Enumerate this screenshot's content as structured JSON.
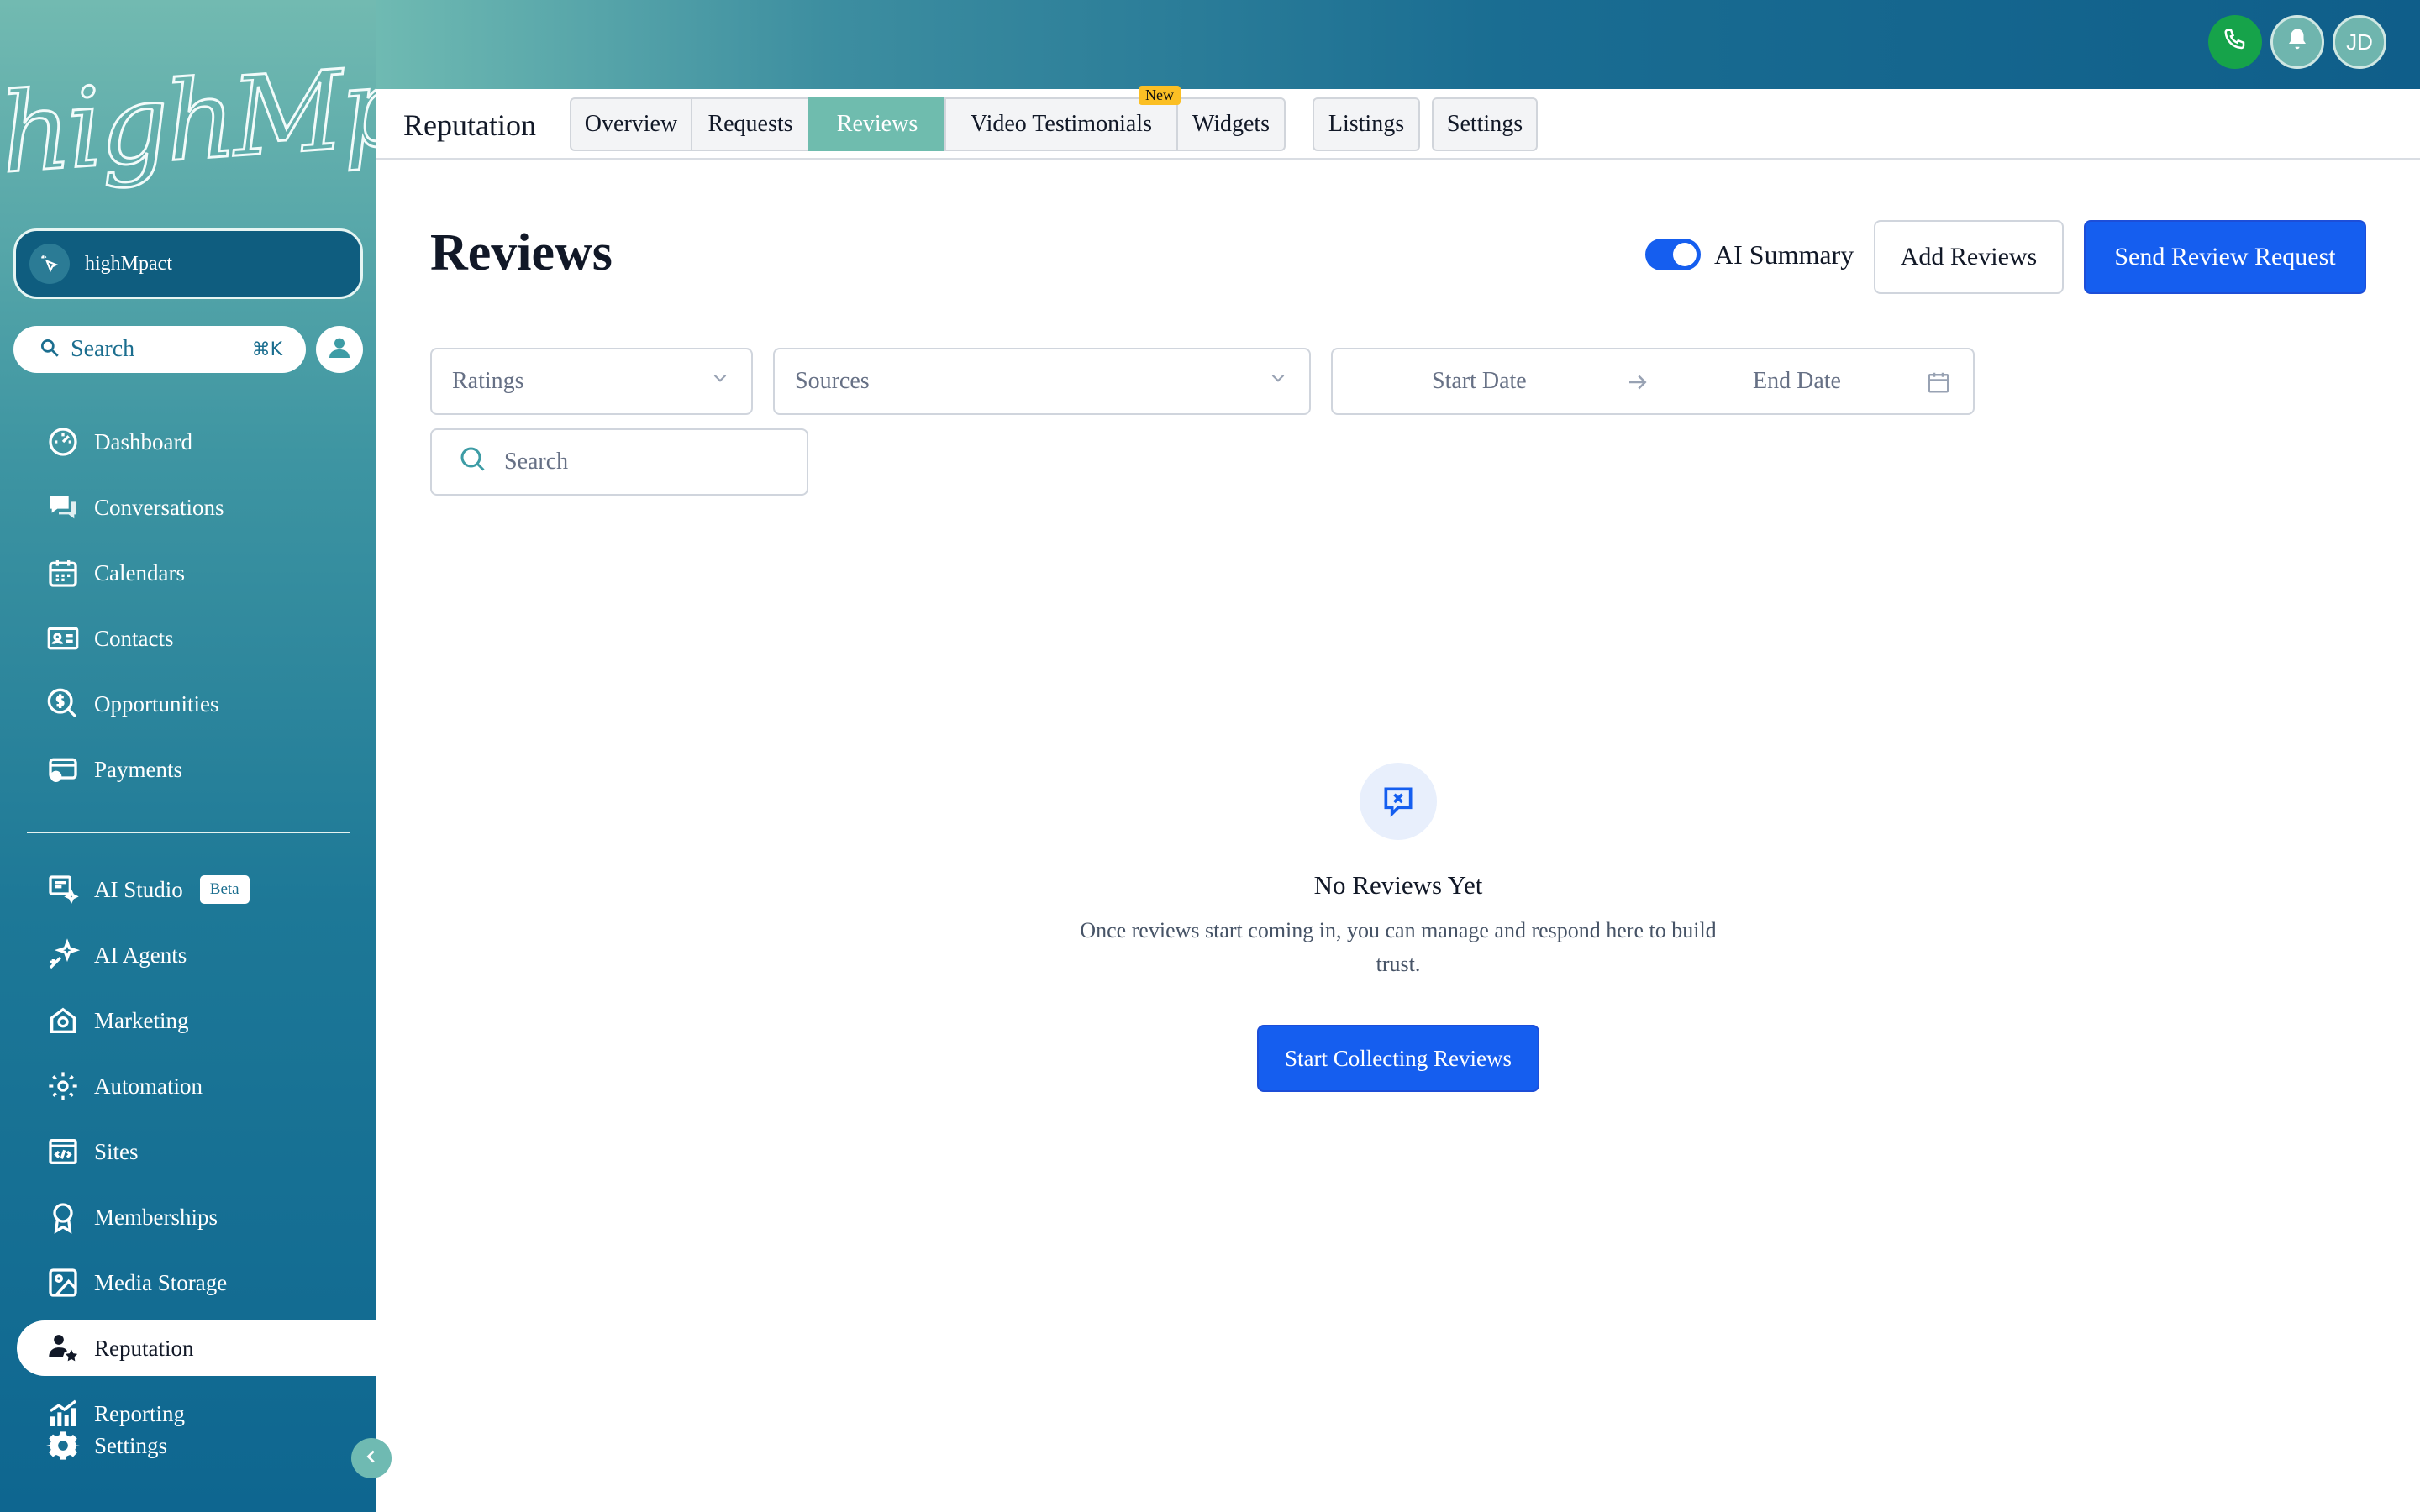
{
  "brand": {
    "logo_text": "highMpact"
  },
  "header": {
    "avatar_initials": "JD"
  },
  "sidebar": {
    "account_name": "highMpact",
    "search_label": "Search",
    "search_shortcut": "⌘K",
    "items": [
      {
        "label": "Dashboard",
        "icon": "dashboard-icon"
      },
      {
        "label": "Conversations",
        "icon": "chat-icon"
      },
      {
        "label": "Calendars",
        "icon": "calendar-icon"
      },
      {
        "label": "Contacts",
        "icon": "contact-card-icon"
      },
      {
        "label": "Opportunities",
        "icon": "dollar-icon"
      },
      {
        "label": "Payments",
        "icon": "payment-card-icon"
      },
      {
        "label": "AI Studio",
        "icon": "ai-studio-icon",
        "badge": "Beta"
      },
      {
        "label": "AI Agents",
        "icon": "sparkle-icon"
      },
      {
        "label": "Marketing",
        "icon": "marketing-icon"
      },
      {
        "label": "Automation",
        "icon": "automation-icon"
      },
      {
        "label": "Sites",
        "icon": "code-window-icon"
      },
      {
        "label": "Memberships",
        "icon": "badge-icon"
      },
      {
        "label": "Media Storage",
        "icon": "image-icon"
      },
      {
        "label": "Reputation",
        "icon": "reputation-icon",
        "active": true
      },
      {
        "label": "Reporting",
        "icon": "chart-icon"
      },
      {
        "label": "Settings",
        "icon": "gear-icon"
      }
    ]
  },
  "subnav": {
    "title": "Reputation",
    "tabs": [
      {
        "label": "Overview"
      },
      {
        "label": "Requests"
      },
      {
        "label": "Reviews",
        "active": true
      },
      {
        "label": "Video Testimonials",
        "badge": "New"
      },
      {
        "label": "Widgets"
      },
      {
        "label": "Listings"
      },
      {
        "label": "Settings"
      }
    ]
  },
  "main": {
    "title": "Reviews",
    "ai_summary_label": "AI Summary",
    "ai_summary_on": true,
    "add_reviews_label": "Add Reviews",
    "send_request_label": "Send Review Request",
    "filters": {
      "ratings_placeholder": "Ratings",
      "sources_placeholder": "Sources",
      "start_date_placeholder": "Start Date",
      "end_date_placeholder": "End Date",
      "search_placeholder": "Search"
    },
    "empty_state": {
      "title": "No Reviews Yet",
      "description": "Once reviews start coming in, you can manage and respond here to build trust.",
      "button_label": "Start Collecting Reviews"
    }
  },
  "colors": {
    "primary": "#155eef",
    "active_tab": "#6fbcae",
    "sidebar_top": "#72bab1",
    "sidebar_bottom": "#0e6690"
  }
}
